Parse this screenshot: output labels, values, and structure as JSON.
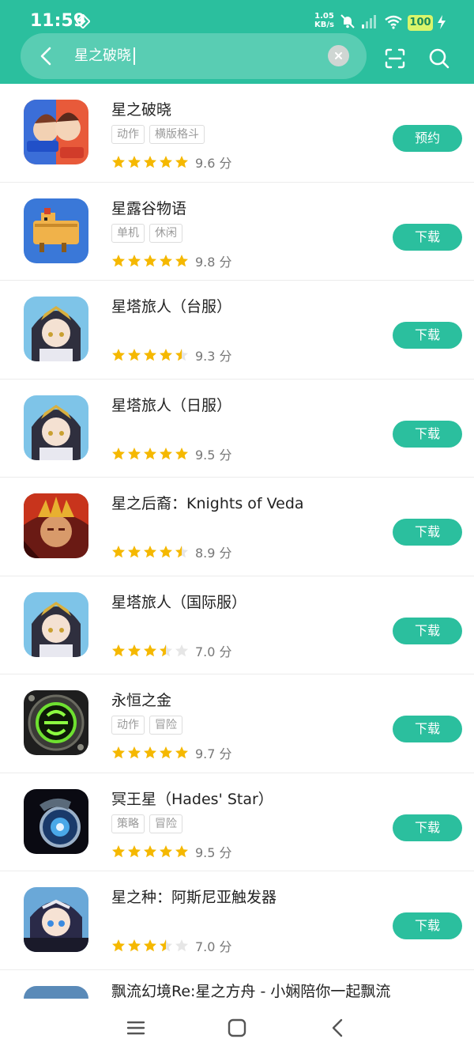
{
  "status": {
    "time": "11:59",
    "net_speed": "1.05",
    "net_unit": "KB/s",
    "battery": "100"
  },
  "search": {
    "query": "星之破晓"
  },
  "results": [
    {
      "title": "星之破晓",
      "tags": [
        "动作",
        "横版格斗"
      ],
      "score": "9.6 分",
      "stars": 5,
      "button": "预约"
    },
    {
      "title": "星露谷物语",
      "tags": [
        "单机",
        "休闲"
      ],
      "score": "9.8 分",
      "stars": 5,
      "button": "下载"
    },
    {
      "title": "星塔旅人（台服）",
      "tags": [],
      "score": "9.3 分",
      "stars": 4.5,
      "button": "下载"
    },
    {
      "title": "星塔旅人（日服）",
      "tags": [],
      "score": "9.5 分",
      "stars": 5,
      "button": "下载"
    },
    {
      "title": "星之后裔：Knights of Veda",
      "tags": [],
      "score": "8.9 分",
      "stars": 4.5,
      "button": "下载"
    },
    {
      "title": "星塔旅人（国际服）",
      "tags": [],
      "score": "7.0 分",
      "stars": 3.5,
      "button": "下载"
    },
    {
      "title": "永恒之金",
      "tags": [
        "动作",
        "冒险"
      ],
      "score": "9.7 分",
      "stars": 5,
      "button": "下载"
    },
    {
      "title": "冥王星（Hades' Star）",
      "tags": [
        "策略",
        "冒险"
      ],
      "score": "9.5 分",
      "stars": 5,
      "button": "下载"
    },
    {
      "title": "星之种：阿斯尼亚触发器",
      "tags": [],
      "score": "7.0 分",
      "stars": 3.5,
      "button": "下载"
    },
    {
      "title": "飘流幻境Re:星之方舟 - 小娴陪你一起飘流",
      "tags": [],
      "score": "",
      "stars": 0,
      "button": ""
    }
  ],
  "icons": [
    "game-icon",
    "game-icon",
    "game-icon",
    "game-icon",
    "game-icon",
    "game-icon",
    "game-icon",
    "game-icon",
    "game-icon",
    "game-icon"
  ],
  "colors": {
    "accent": "#2bbf9e",
    "star": "#f5b800",
    "star_empty": "#e6e6e6"
  }
}
